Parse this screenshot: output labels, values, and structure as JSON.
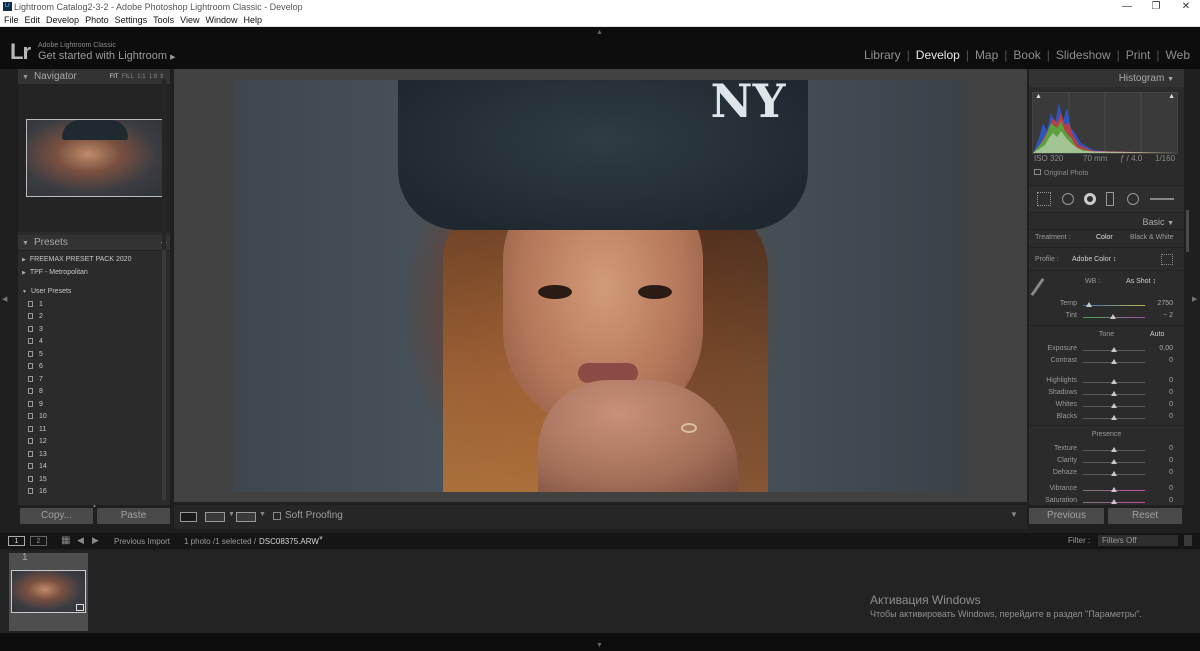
{
  "window": {
    "title": "Lightroom Catalog2-3-2 - Adobe Photoshop Lightroom Classic - Develop",
    "app_icon": "Lr",
    "minimize": "—",
    "maximize": "❐",
    "close": "✕"
  },
  "menu": [
    "File",
    "Edit",
    "Develop",
    "Photo",
    "Settings",
    "Tools",
    "View",
    "Window",
    "Help"
  ],
  "identity": {
    "logo": "Lr",
    "small": "Adobe Lightroom Classic",
    "big": "Get started with Lightroom"
  },
  "modules": [
    "Library",
    "Develop",
    "Map",
    "Book",
    "Slideshow",
    "Print",
    "Web"
  ],
  "active_module": "Develop",
  "navigator": {
    "title": "Navigator",
    "opts": [
      "FIT",
      "FILL",
      "1:1",
      "1:8"
    ]
  },
  "presets": {
    "title": "Presets",
    "groups": [
      "FREEMAX PRESET PACK 2020",
      "TPF - Metropolitan"
    ],
    "user_group": "User Presets",
    "user_items": [
      "1",
      "2",
      "3",
      "4",
      "5",
      "6",
      "7",
      "8",
      "9",
      "10",
      "11",
      "12",
      "13",
      "14",
      "15",
      "16"
    ]
  },
  "left_buttons": {
    "copy": "Copy...",
    "paste": "Paste"
  },
  "photo": {
    "logo_text": "NY"
  },
  "toolbar": {
    "soft_proofing": "Soft Proofing"
  },
  "histogram": {
    "title": "Histogram",
    "iso": "ISO 320",
    "focal": "70 mm",
    "aperture": "ƒ / 4.0",
    "shutter": "1/160",
    "original_photo": "Original Photo"
  },
  "basic": {
    "title": "Basic",
    "treatment_label": "Treatment :",
    "treatment_color": "Color",
    "treatment_bw": "Black & White",
    "profile_label": "Profile :",
    "profile_value": "Adobe Color ↕",
    "wb_label": "WB :",
    "wb_value": "As Shot ↕",
    "temp": {
      "label": "Temp",
      "value": "2750",
      "position": 0.1
    },
    "tint": {
      "label": "Tint",
      "value": "− 2",
      "position": 0.49
    },
    "tone_label": "Tone",
    "auto_label": "Auto",
    "exposure": {
      "label": "Exposure",
      "value": "0,00",
      "position": 0.5
    },
    "contrast": {
      "label": "Contrast",
      "value": "0",
      "position": 0.5
    },
    "highlights": {
      "label": "Highlights",
      "value": "0",
      "position": 0.5
    },
    "shadows": {
      "label": "Shadows",
      "value": "0",
      "position": 0.5
    },
    "whites": {
      "label": "Whites",
      "value": "0",
      "position": 0.5
    },
    "blacks": {
      "label": "Blacks",
      "value": "0",
      "position": 0.5
    },
    "presence_label": "Presence",
    "texture": {
      "label": "Texture",
      "value": "0",
      "position": 0.5
    },
    "clarity": {
      "label": "Clarity",
      "value": "0",
      "position": 0.5
    },
    "dehaze": {
      "label": "Dehaze",
      "value": "0",
      "position": 0.5
    },
    "vibrance": {
      "label": "Vibrance",
      "value": "0",
      "position": 0.5
    },
    "saturation": {
      "label": "Saturation",
      "value": "0",
      "position": 0.5
    }
  },
  "right_buttons": {
    "previous": "Previous",
    "reset": "Reset"
  },
  "filmbar": {
    "page1": "1",
    "page2": "2",
    "source": "Previous Import",
    "count": "1 photo /1 selected /",
    "filename": "DSC08375.ARW",
    "filter_label": "Filter :",
    "filter_value": "Filters Off"
  },
  "filmstrip": {
    "index": "1"
  },
  "windows_activation": {
    "title": "Активация Windows",
    "subtitle": "Чтобы активировать Windows, перейдите в раздел \"Параметры\"."
  }
}
